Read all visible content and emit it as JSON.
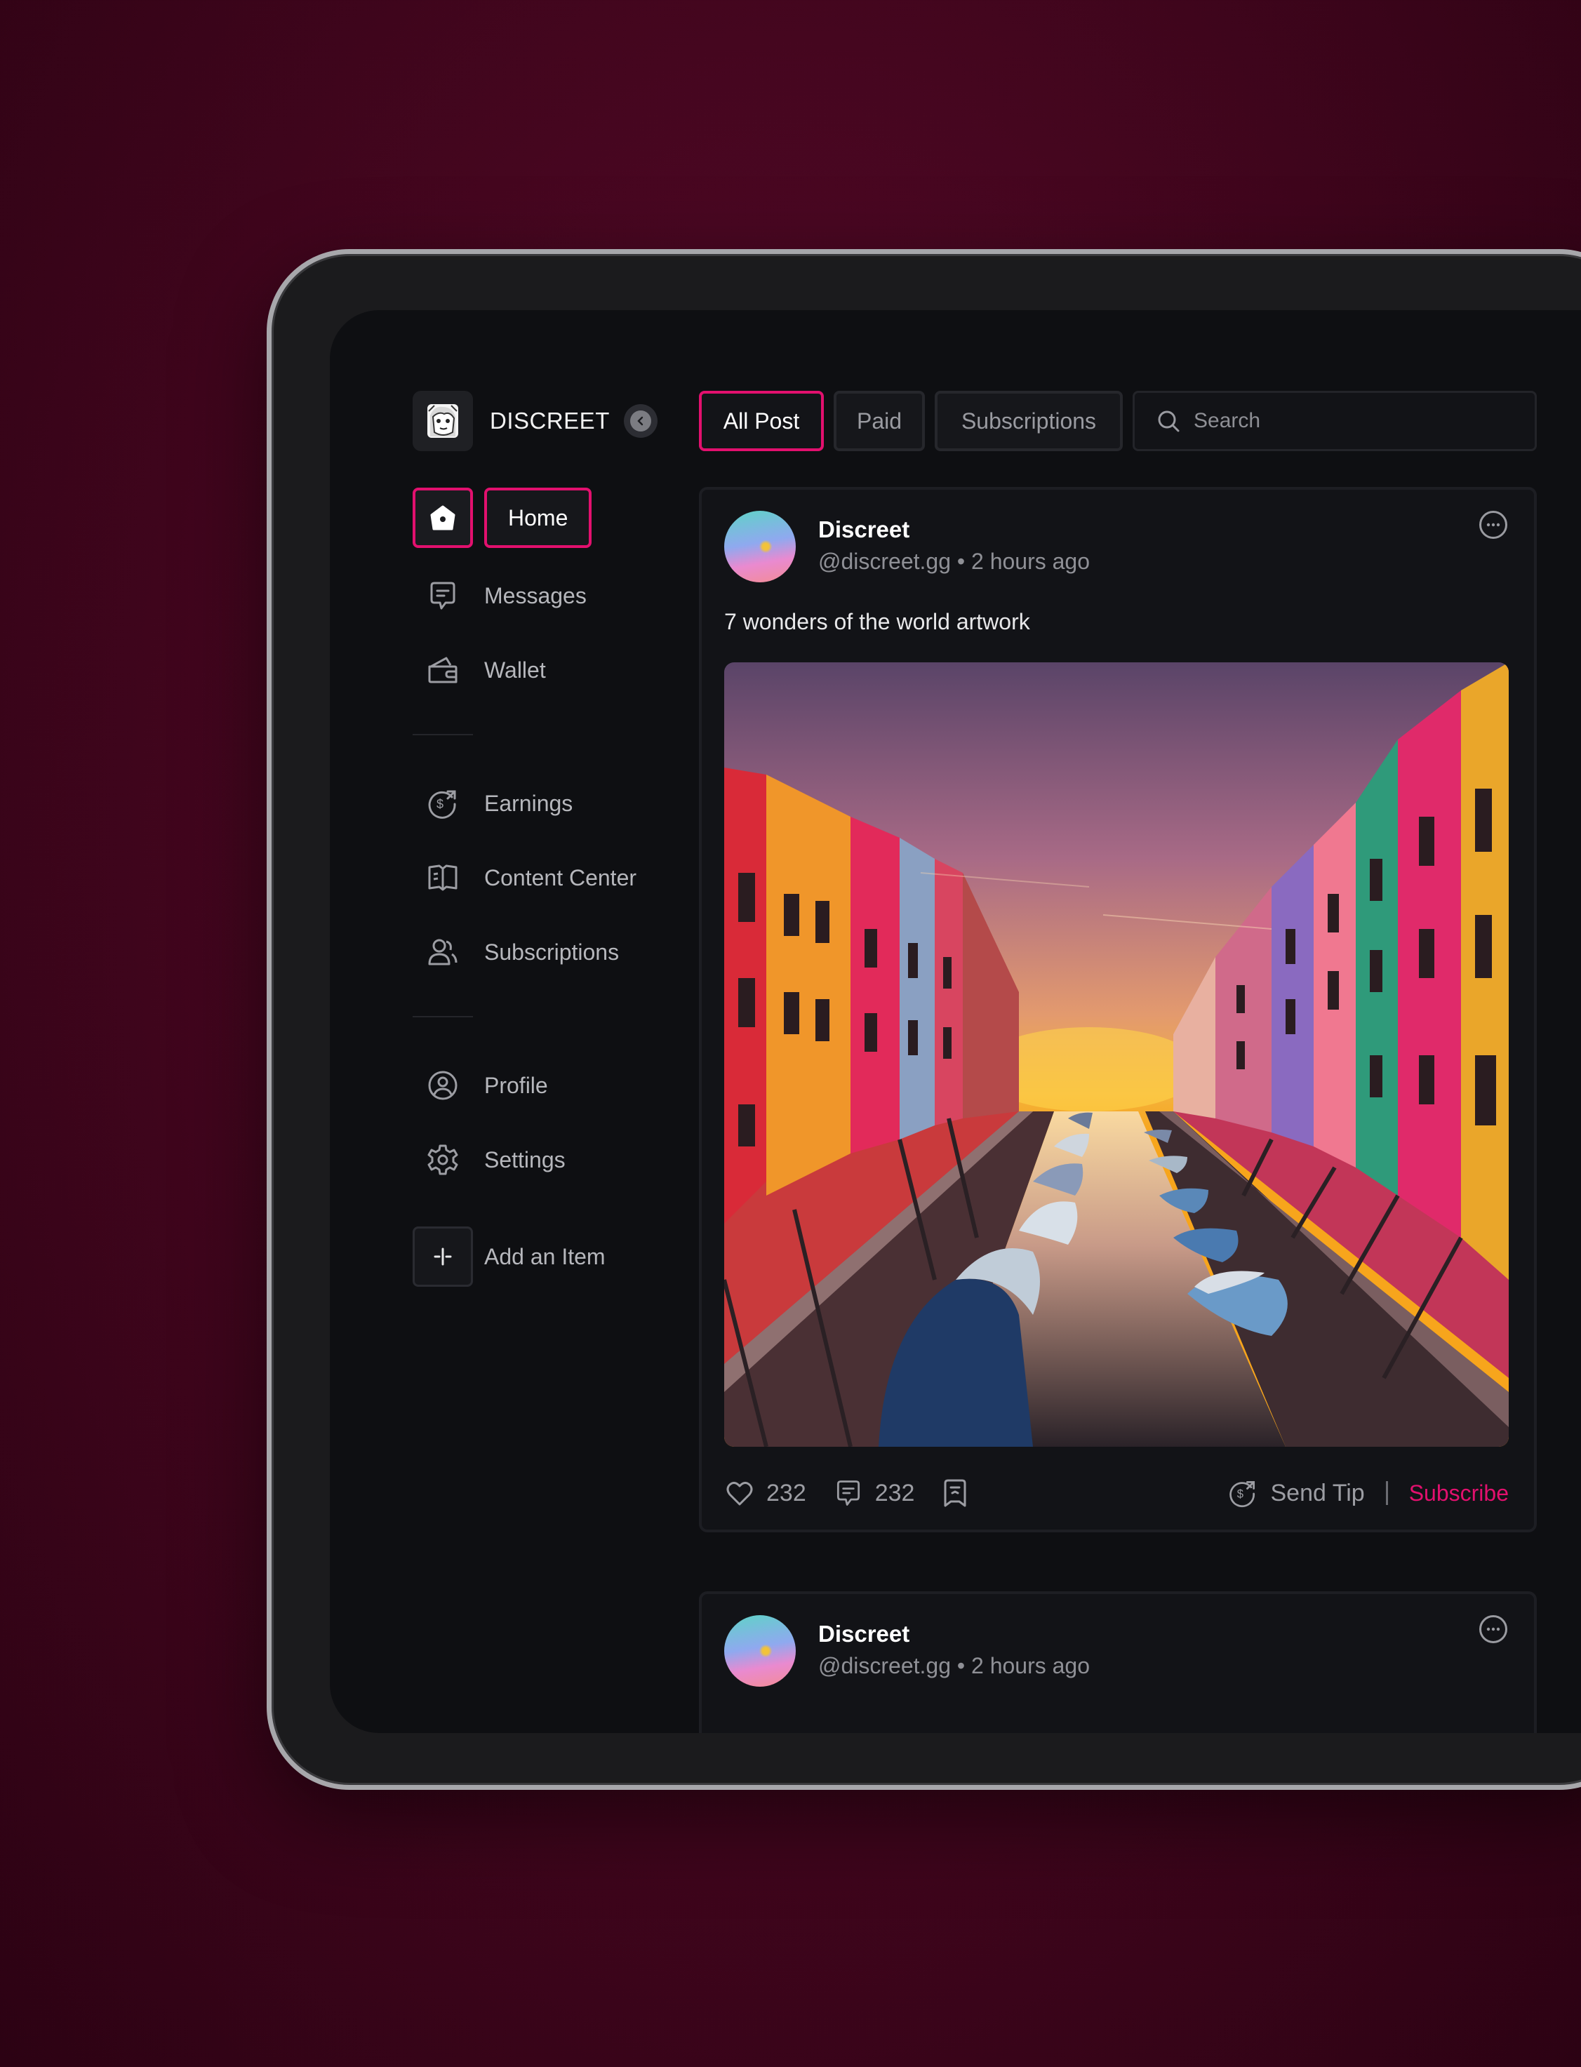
{
  "brand": {
    "name": "DISCREET"
  },
  "sidebar": {
    "items": [
      {
        "label": "Home",
        "icon": "home-icon",
        "active": true
      },
      {
        "label": "Messages",
        "icon": "message-icon"
      },
      {
        "label": "Wallet",
        "icon": "wallet-icon"
      },
      {
        "label": "Earnings",
        "icon": "earnings-icon"
      },
      {
        "label": "Content Center",
        "icon": "book-icon"
      },
      {
        "label": "Subscriptions",
        "icon": "users-icon"
      },
      {
        "label": "Profile",
        "icon": "profile-icon"
      },
      {
        "label": "Settings",
        "icon": "gear-icon"
      }
    ],
    "add_item_label": "Add an Item"
  },
  "tabs": [
    {
      "label": "All Post",
      "active": true
    },
    {
      "label": "Paid"
    },
    {
      "label": "Subscriptions"
    }
  ],
  "search": {
    "placeholder": "Search"
  },
  "posts": [
    {
      "author": "Discreet",
      "meta": "@discreet.gg • 2 hours ago",
      "caption": "7 wonders of the world artwork",
      "likes": "232",
      "comments": "232",
      "tip_label": "Send Tip",
      "subscribe_label": "Subscribe"
    },
    {
      "author": "Discreet",
      "meta": "@discreet.gg • 2 hours ago"
    }
  ],
  "colors": {
    "accent": "#e2106e",
    "background": "#0e0f12",
    "backdrop": "#45061f"
  }
}
